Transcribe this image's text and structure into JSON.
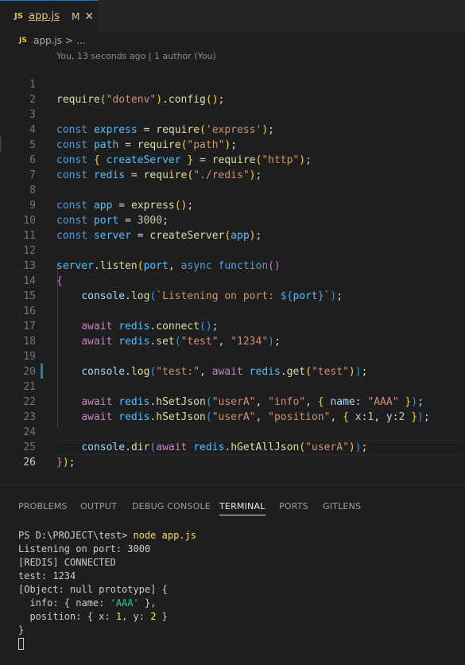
{
  "tab": {
    "icon_text": "JS",
    "name": "app.js",
    "status": "M",
    "close": "✕"
  },
  "breadcrumb": {
    "icon_text": "JS",
    "file": "app.js",
    "separator": ">",
    "more": "..."
  },
  "blame": "You, 13 seconds ago | 1 author (You)",
  "editor": {
    "line_numbers": [
      "1",
      "2",
      "3",
      "4",
      "5",
      "6",
      "7",
      "8",
      "9",
      "10",
      "11",
      "12",
      "13",
      "14",
      "15",
      "16",
      "17",
      "18",
      "19",
      "20",
      "21",
      "22",
      "23",
      "24",
      "25",
      "26"
    ],
    "current_line": "26"
  },
  "panel": {
    "tabs": [
      "PROBLEMS",
      "OUTPUT",
      "DEBUG CONSOLE",
      "TERMINAL",
      "PORTS",
      "GITLENS"
    ],
    "active_tab": "TERMINAL"
  },
  "terminal": {
    "prompt": "PS D:\\PROJECT\\test> ",
    "command": "node app.js",
    "out1": "Listening on port: 3000",
    "out2": "[REDIS] CONNECTED",
    "out3": "test: 1234",
    "out4": "[Object: null prototype] {",
    "out5_a": "  info: { name: ",
    "out5_b": "'AAA'",
    "out5_c": " },",
    "out6_a": "  position: { x: ",
    "out6_b": "1",
    "out6_c": ", y: ",
    "out6_d": "2",
    "out6_e": " }",
    "out7": "}"
  },
  "colors": {
    "accent": "#0078d4",
    "modified_bar": "#1b81a8",
    "string": "#ce9178",
    "keyword": "#569cd6"
  }
}
